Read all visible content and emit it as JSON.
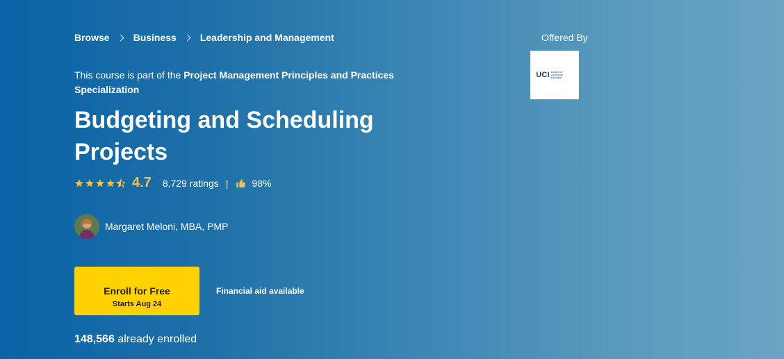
{
  "breadcrumb": {
    "items": [
      "Browse",
      "Business",
      "Leadership and Management"
    ]
  },
  "specialization": {
    "prefix": "This course is part of the ",
    "name": "Project Management Principles and Practices Specialization"
  },
  "course": {
    "title": "Budgeting and Scheduling Projects",
    "rating": "4.7",
    "rating_stars": 4.5,
    "ratings_count": "8,729 ratings",
    "separator": "|",
    "approval": "98%"
  },
  "instructor": {
    "name": "Margaret Meloni, MBA, PMP"
  },
  "enroll": {
    "label": "Enroll for Free",
    "start": "Starts Aug 24",
    "financial_aid": "Financial aid available"
  },
  "enrolled": {
    "count": "148,566",
    "suffix": " already enrolled"
  },
  "offered_by": {
    "label": "Offered By",
    "logo_text": "UCI",
    "logo_subtext": "Division of Continuing Education"
  },
  "colors": {
    "accent_yellow": "#ffd200",
    "rating_gold": "#f5c04a",
    "bg_start": "#0a63a6",
    "bg_end": "#6aa5c2"
  }
}
